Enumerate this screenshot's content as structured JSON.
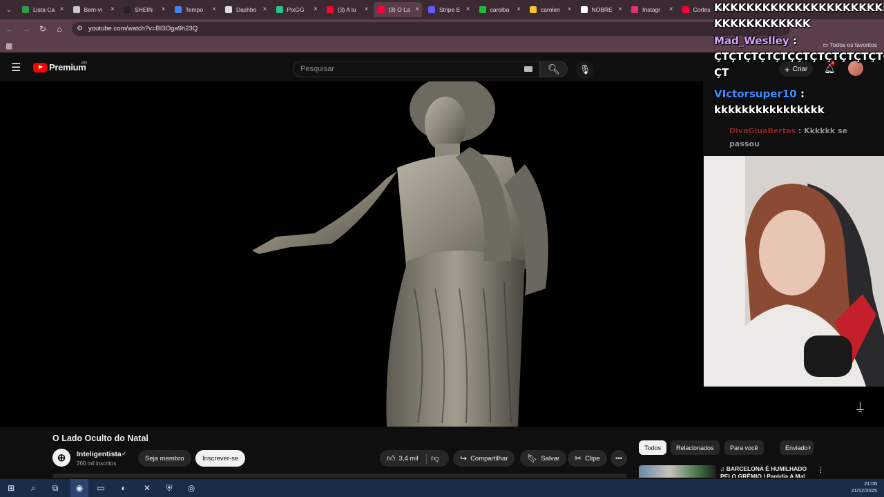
{
  "browser": {
    "tabs": [
      {
        "label": "Lista Ca",
        "color": "#2e9e4f"
      },
      {
        "label": "Bem-vi",
        "color": "#c9c9c9"
      },
      {
        "label": "SHEIN",
        "color": "#222222"
      },
      {
        "label": "Tempo",
        "color": "#4285f4"
      },
      {
        "label": "Dashbo",
        "color": "#dddddd"
      },
      {
        "label": "PixGG",
        "color": "#29c48c"
      },
      {
        "label": "(3) A lu",
        "color": "#ff0033"
      },
      {
        "label": "(3) O La",
        "color": "#ff0033",
        "active": true
      },
      {
        "label": "Stripe E",
        "color": "#635bff"
      },
      {
        "label": "carolba",
        "color": "#1fbd3f"
      },
      {
        "label": "carolen",
        "color": "#f4c430"
      },
      {
        "label": "NOBRE",
        "color": "#ffffff"
      },
      {
        "label": "Instagr",
        "color": "#e1306c"
      },
      {
        "label": "Cortes",
        "color": "#ff0033"
      }
    ],
    "url": "youtube.com/watch?v=BI3Oga9h23Q",
    "bookmarks_folder": "Todos os favoritos"
  },
  "youtube": {
    "logo_text": "Premium",
    "region": "BR",
    "search_placeholder": "Pesquisar",
    "create_label": "Criar",
    "notification_count": "3",
    "video": {
      "title": "O Lado Oculto do Natal",
      "channel": "Inteligentista",
      "subscribers": "260 mil inscritos",
      "join_label": "Seja membro",
      "subscribe_label": "Inscrever-se",
      "likes": "3,4 mil",
      "share_label": "Compartilhar",
      "save_label": "Salvar",
      "clip_label": "Clipe"
    },
    "chips": [
      "Todos",
      "Relacionados",
      "Para você",
      "Enviado"
    ],
    "recommendation_title": "♫ BARCELONA É HUMILHADO PELO GRÊMIO | Paródia A Mal"
  },
  "chat": [
    {
      "user": "",
      "message": "KKKKKKKKKKKKKKKKKKKKKKK KKKKKKKKKKKK",
      "color": "#ffffff"
    },
    {
      "user": "Mad_Weslley",
      "message": "ÇTÇTÇTÇTÇTÇÇTÇTÇTÇTÇTÇTÇ ÇT",
      "color": "#d9a7ff"
    },
    {
      "user": "VIctorsuper10",
      "message": "kkkkkkkkkkkkkkkk",
      "color": "#3b8fff"
    },
    {
      "user": "DivaGiuaBertas",
      "message": "Kkkkkk se passou",
      "color": "#ff3b3b"
    }
  ],
  "taskbar": {
    "time": "21:06",
    "date": "21/12/2025"
  }
}
